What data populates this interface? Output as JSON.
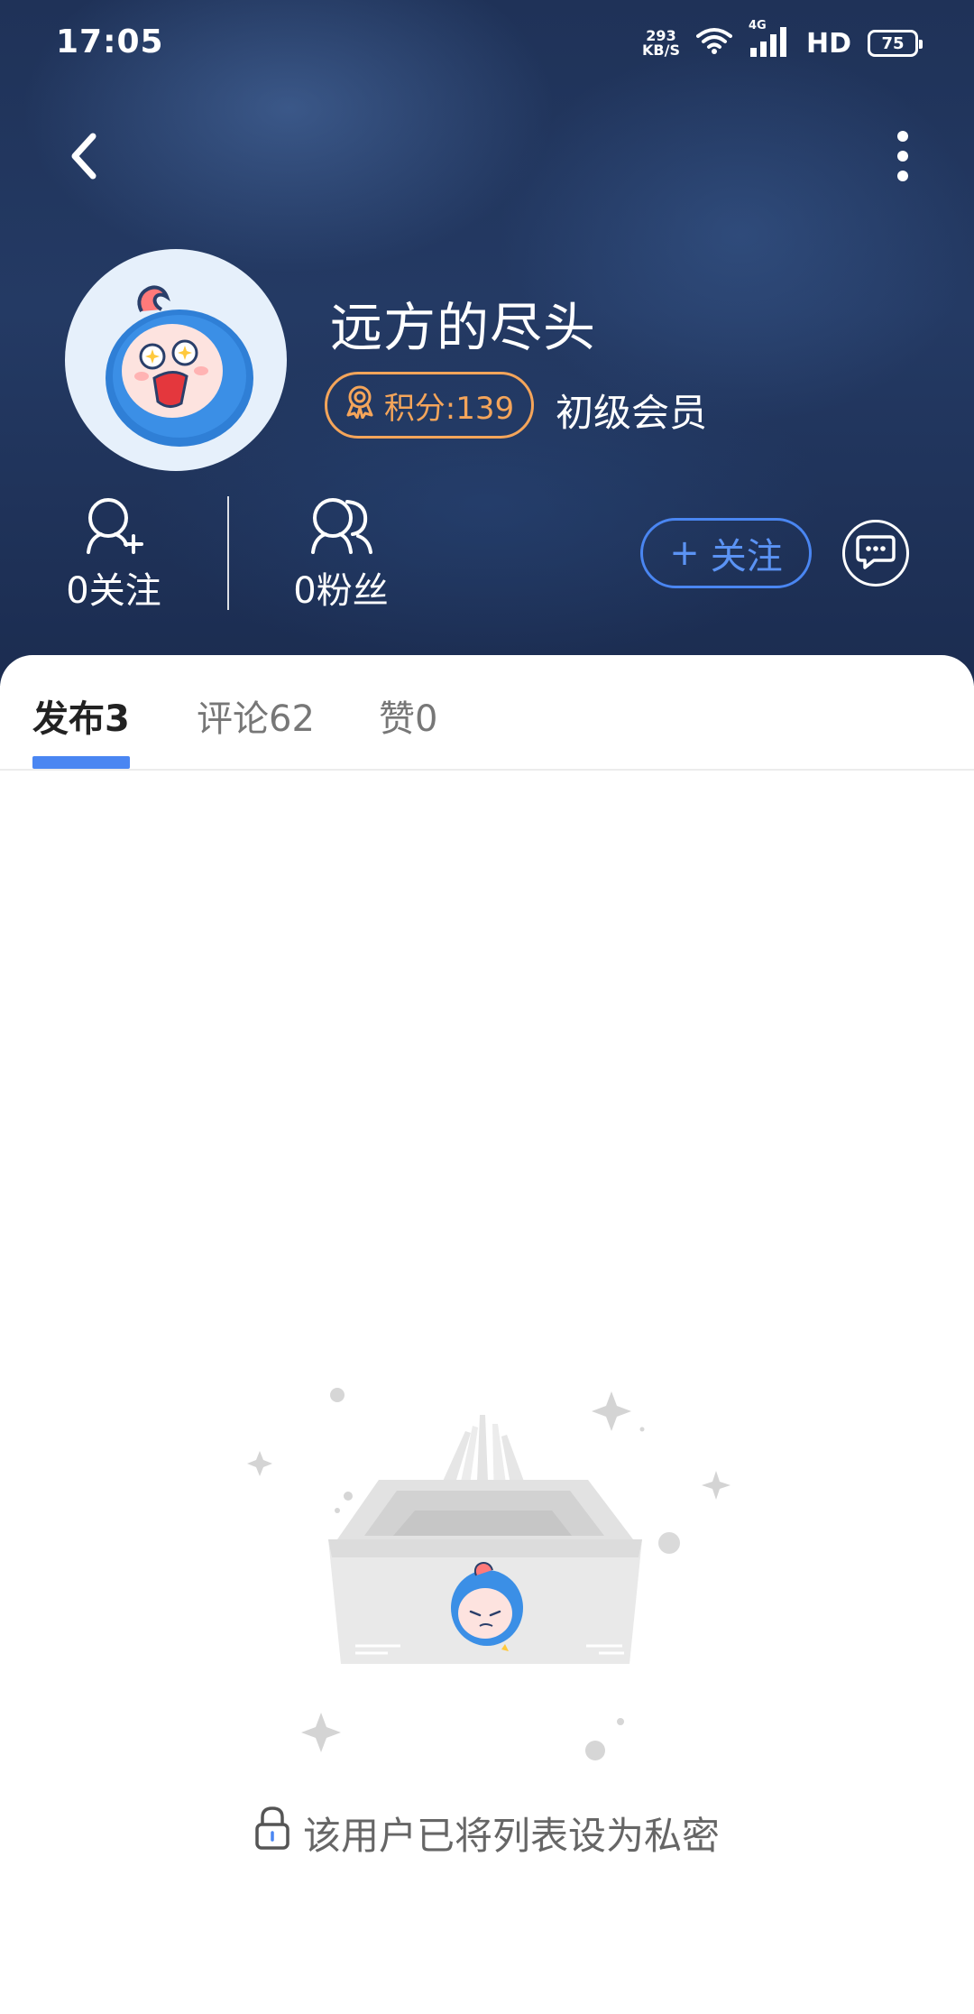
{
  "status_bar": {
    "time": "17:05",
    "net_speed_value": "293",
    "net_speed_unit": "KB/S",
    "network_type": "4G",
    "hd_label": "HD",
    "battery_level": "75"
  },
  "profile": {
    "username": "远方的尽头",
    "points_label": "积分:139",
    "member_level": "初级会员",
    "following_label": "0关注",
    "fans_label": "0粉丝",
    "follow_button_label": "关注",
    "follow_button_plus": "+"
  },
  "tabs": [
    {
      "label": "发布3",
      "active": true
    },
    {
      "label": "评论62",
      "active": false
    },
    {
      "label": "赞0",
      "active": false
    }
  ],
  "empty_state": {
    "message": "该用户已将列表设为私密"
  },
  "colors": {
    "accent_blue": "#4a86f2",
    "points_orange": "#f5a55a",
    "header_navy": "#1f3258"
  },
  "icons": {
    "back": "chevron-left-icon",
    "more": "more-vertical-icon",
    "medal": "medal-icon",
    "following": "user-plus-icon",
    "fans": "users-icon",
    "chat": "chat-bubble-icon",
    "lock": "lock-icon"
  }
}
